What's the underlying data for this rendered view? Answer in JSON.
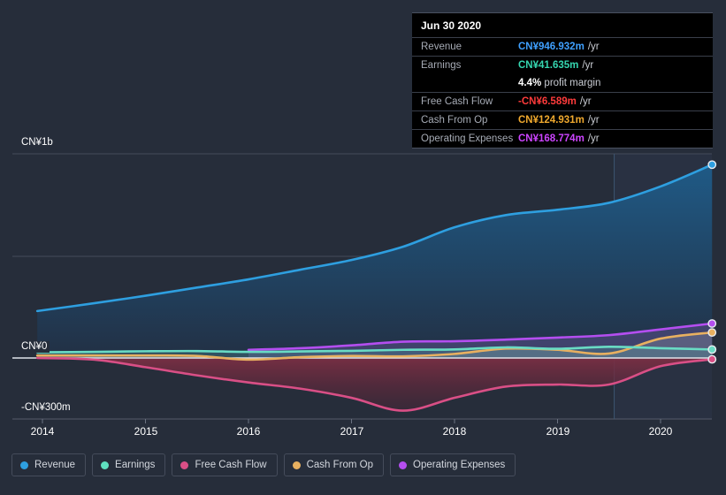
{
  "chart_data": {
    "type": "area",
    "title": "",
    "xlabel": "",
    "ylabel": "",
    "currency": "CN¥",
    "grid": true,
    "legend_position": "bottom",
    "ylim": [
      -300000000,
      1000000000
    ],
    "xlim": [
      "2013.75",
      "2020.6"
    ],
    "x_ticks": [
      "2014",
      "2015",
      "2016",
      "2017",
      "2018",
      "2019",
      "2020"
    ],
    "y_ticks": [
      {
        "label": "CN¥1b",
        "value": 1000000000
      },
      {
        "label": "CN¥0",
        "value": 0
      },
      {
        "label": "-CN¥300m",
        "value": -300000000
      }
    ],
    "x": [
      2013.95,
      2014.5,
      2015.0,
      2015.5,
      2016.0,
      2016.5,
      2017.0,
      2017.5,
      2018.0,
      2018.5,
      2019.0,
      2019.5,
      2020.0,
      2020.5
    ],
    "series": [
      {
        "name": "Revenue",
        "color": "#2e9fe0",
        "fill": "#1d4a6e",
        "values": [
          230,
          268,
          305,
          345,
          385,
          432,
          480,
          545,
          640,
          700,
          726,
          760,
          840,
          946.932
        ],
        "unit": "m"
      },
      {
        "name": "Earnings",
        "color": "#69dbc4",
        "fill": "#3c6a78",
        "values": [
          28,
          30,
          33,
          34,
          30,
          32,
          35,
          40,
          42,
          52,
          45,
          55,
          48,
          41.635
        ],
        "unit": "m"
      },
      {
        "name": "Free Cash Flow",
        "color": "#d94f86",
        "fill": "#6e2c3e",
        "values": [
          0,
          -8,
          -45,
          -85,
          -120,
          -150,
          -195,
          -258,
          -195,
          -140,
          -130,
          -130,
          -40,
          -6.589
        ],
        "unit": "m"
      },
      {
        "name": "Cash From Op",
        "color": "#e8b060",
        "fill": "#5a5668",
        "values": [
          12,
          12,
          12,
          10,
          -8,
          4,
          10,
          8,
          20,
          46,
          40,
          22,
          95,
          124.931
        ],
        "unit": "m"
      },
      {
        "name": "Operating Expenses",
        "color": "#b44ef0",
        "fill": "#4a3b7a",
        "values": [
          null,
          null,
          null,
          null,
          40,
          48,
          62,
          80,
          82,
          90,
          100,
          112,
          140,
          168.774
        ],
        "unit": "m"
      }
    ],
    "forecast_divider_x": 2019.55,
    "endpoint_markers": true
  },
  "tooltip": {
    "title": "Jun 30 2020",
    "rows": [
      {
        "label": "Revenue",
        "value": "CN¥946.932m",
        "unit": "/yr",
        "color": "#3fa0ff"
      },
      {
        "label": "Earnings",
        "value": "CN¥41.635m",
        "unit": "/yr",
        "color": "#35d6b0",
        "sub_value": "4.4%",
        "sub_label": "profit margin"
      },
      {
        "label": "Free Cash Flow",
        "value": "-CN¥6.589m",
        "unit": "/yr",
        "color": "#ff3b3b"
      },
      {
        "label": "Cash From Op",
        "value": "CN¥124.931m",
        "unit": "/yr",
        "color": "#f0a92e"
      },
      {
        "label": "Operating Expenses",
        "value": "CN¥168.774m",
        "unit": "/yr",
        "color": "#cc44ff"
      }
    ]
  },
  "legend": {
    "items": [
      {
        "label": "Revenue",
        "color": "#2e9fe0"
      },
      {
        "label": "Earnings",
        "color": "#5fe0c0"
      },
      {
        "label": "Free Cash Flow",
        "color": "#d94f86"
      },
      {
        "label": "Cash From Op",
        "color": "#e8b060"
      },
      {
        "label": "Operating Expenses",
        "color": "#b44ef0"
      }
    ]
  },
  "axis": {
    "y_labels": [
      "CN¥1b",
      "CN¥0",
      "-CN¥300m"
    ],
    "x_labels": [
      "2014",
      "2015",
      "2016",
      "2017",
      "2018",
      "2019",
      "2020"
    ]
  }
}
